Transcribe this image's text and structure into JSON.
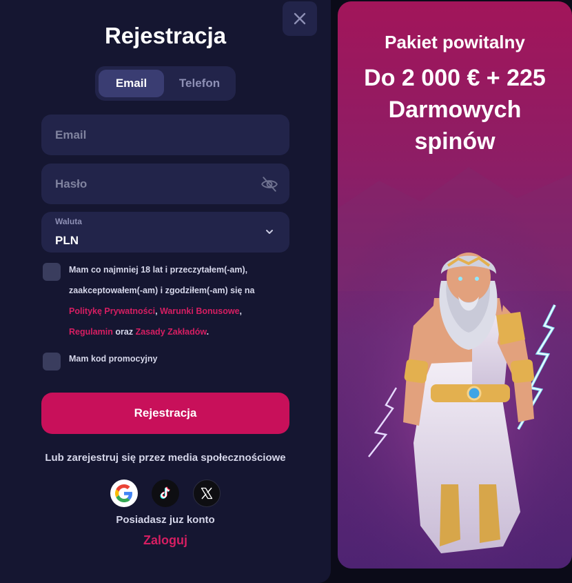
{
  "form": {
    "title": "Rejestracja",
    "tabs": [
      {
        "label": "Email",
        "active": true
      },
      {
        "label": "Telefon",
        "active": false
      }
    ],
    "email_placeholder": "Email",
    "password_placeholder": "Hasło",
    "currency": {
      "label": "Waluta",
      "value": "PLN"
    },
    "terms": {
      "line1": "Mam co najmniej 18 lat i przeczytałem(-am),",
      "line2": "zaakceptowałem(-am) i zgodziłem(-am) się na",
      "privacy_link": "Politykę Prywatności",
      "sep1": ", ",
      "bonus_link": "Warunki Bonusowe",
      "sep2": ",",
      "rules_link": "Regulamin",
      "and": " oraz ",
      "betting_link": "Zasady Zakładów",
      "end": "."
    },
    "promo_label": "Mam kod promocyjny",
    "submit_label": "Rejestracja",
    "social_text": "Lub zarejestruj się przez media społecznościowe",
    "social": [
      "google-icon",
      "tiktok-icon",
      "x-icon"
    ],
    "has_account": "Posiadasz juz konto",
    "login_label": "Zaloguj"
  },
  "promo": {
    "subtitle": "Pakiet powitalny",
    "line1": "Do 2 000 € + 225",
    "line2": "Darmowych",
    "line3": "spinów"
  },
  "icons": {
    "close": "close-icon",
    "eye": "eye-slash-icon",
    "chevron": "chevron-down-icon"
  },
  "colors": {
    "accent": "#c8105a",
    "link": "#d61e62",
    "panel": "#151631",
    "field": "#22244a"
  }
}
